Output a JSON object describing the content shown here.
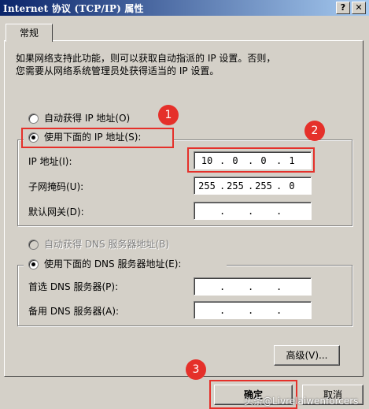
{
  "window": {
    "title": "Internet 协议 (TCP/IP) 属性",
    "help_glyph": "?",
    "close_glyph": "✕"
  },
  "tab": {
    "label": "常规"
  },
  "description": "如果网络支持此功能，则可以获取自动指派的 IP 设置。否则，\n您需要从网络系统管理员处获得适当的 IP 设置。",
  "ip_mode": {
    "auto_label": "自动获得 IP 地址(O)",
    "manual_label": "使用下面的 IP 地址(S):",
    "selected": "manual"
  },
  "ip_fields": {
    "ip_label": "IP 地址(I):",
    "ip_value": [
      "10",
      "0",
      "0",
      "1"
    ],
    "mask_label": "子网掩码(U):",
    "mask_value": [
      "255",
      "255",
      "255",
      "0"
    ],
    "gateway_label": "默认网关(D):",
    "gateway_value": [
      "",
      "",
      "",
      ""
    ]
  },
  "dns_mode": {
    "auto_label": "自动获得 DNS 服务器地址(B)",
    "manual_label": "使用下面的 DNS 服务器地址(E):",
    "selected": "manual"
  },
  "dns_fields": {
    "preferred_label": "首选 DNS 服务器(P):",
    "preferred_value": [
      "",
      "",
      "",
      ""
    ],
    "alternate_label": "备用 DNS 服务器(A):",
    "alternate_value": [
      "",
      "",
      "",
      ""
    ]
  },
  "buttons": {
    "advanced": "高级(V)...",
    "ok": "确定",
    "cancel": "取消"
  },
  "annotations": {
    "badge1": "1",
    "badge2": "2",
    "badge3": "3"
  },
  "watermark": "头条@Livrelaiwenforcers",
  "colors": {
    "annotation_red": "#e5302a",
    "title_bar": "#0a246a",
    "dialog_bg": "#d4d0c8"
  }
}
